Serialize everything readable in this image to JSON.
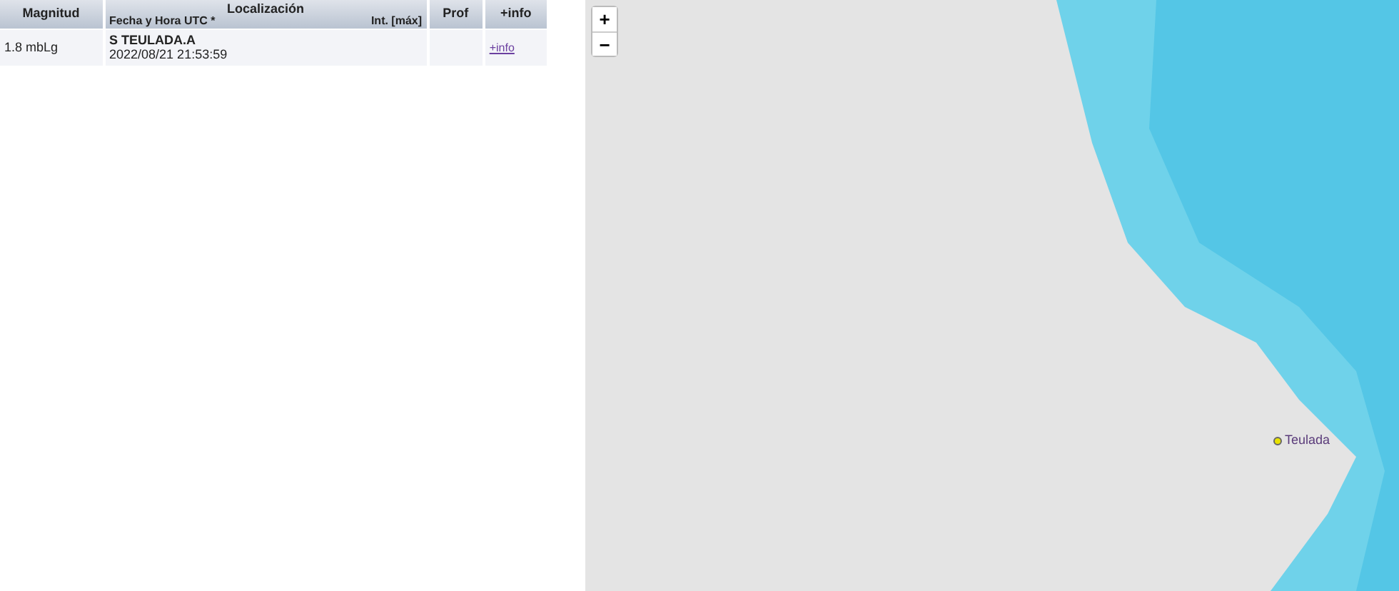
{
  "table": {
    "columns": [
      {
        "label": "Magnitud"
      },
      {
        "label": "Localización",
        "sublabels": [
          "Fecha y Hora UTC *",
          "Int. [máx]"
        ]
      },
      {
        "label": "Prof"
      },
      {
        "label": "+info"
      }
    ],
    "rows": [
      {
        "magnitude": "1.8 mbLg",
        "location": "S TEULADA.A",
        "datetime": "2022/08/21 21:53:59",
        "depth": "",
        "info_link": "+info"
      }
    ]
  },
  "map": {
    "zoom_in": "+",
    "zoom_out": "−",
    "marker": {
      "label": "Teulada"
    }
  }
}
